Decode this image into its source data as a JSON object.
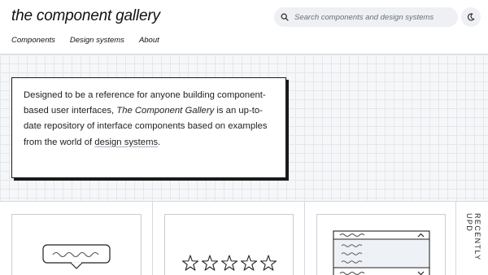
{
  "site": {
    "title": "the component gallery"
  },
  "search": {
    "placeholder": "Search components and design systems"
  },
  "theme_toggle": {
    "icon": "moon-icon"
  },
  "nav": {
    "components": "Components",
    "design_systems": "Design systems",
    "about": "About"
  },
  "intro": {
    "text_before": "Designed to be a reference for anyone building component-based user interfaces, ",
    "emphasis": "The Component Gallery",
    "text_middle": " is an up-to-date repository of interface components based on examples from the world of ",
    "link": "design systems",
    "text_after": "."
  },
  "gallery": {
    "cards": [
      {
        "icon": "tooltip-illustration"
      },
      {
        "icon": "rating-illustration"
      },
      {
        "icon": "select-illustration"
      }
    ],
    "side_label": "RECENTLY UPD"
  }
}
